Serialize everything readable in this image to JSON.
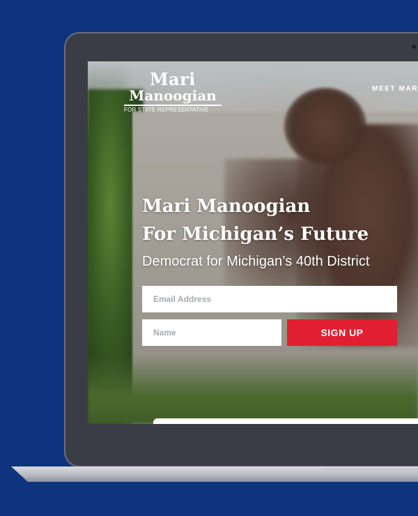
{
  "logo": {
    "first": "Mari",
    "last": "Manoogian",
    "tagline": "FOR STATE REPRESENTATIVE"
  },
  "nav": {
    "meet": "MEET MAR"
  },
  "hero": {
    "title_line1": "Mari Manoogian",
    "title_line2": "For Michigan’s Future",
    "subtitle": "Democrat for Michigan’s 40th District"
  },
  "form": {
    "email_placeholder": "Email Address",
    "name_placeholder": "Name",
    "signup_label": "SIGN UP"
  },
  "colors": {
    "background": "#0e3480",
    "signup_button": "#e21f32"
  }
}
